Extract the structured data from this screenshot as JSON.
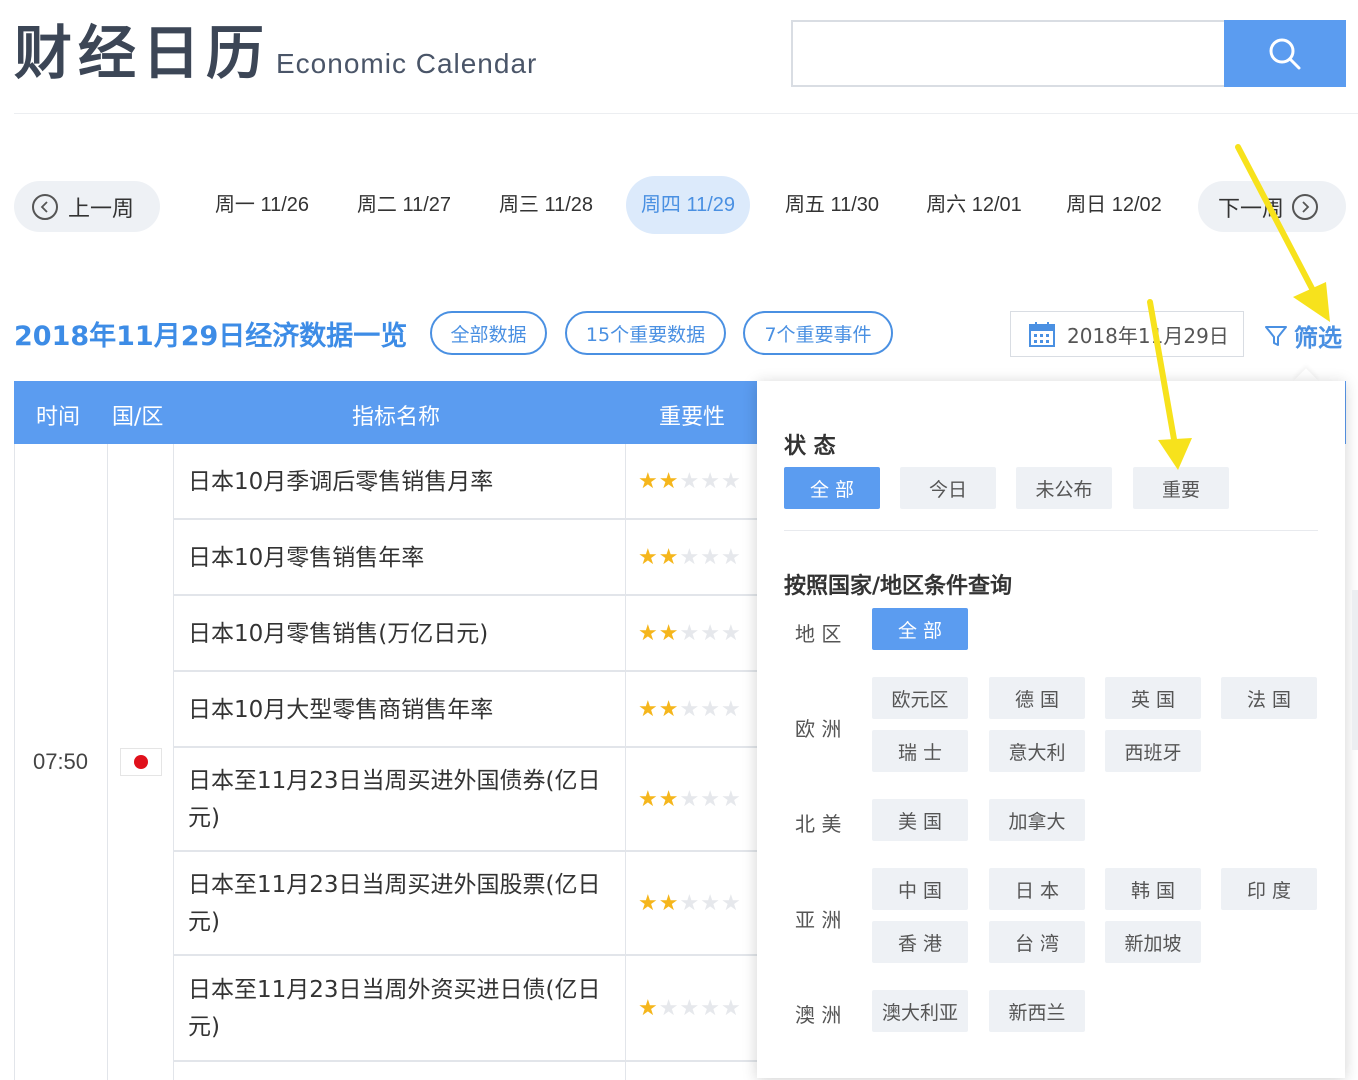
{
  "header": {
    "title_cn": "财经日历",
    "title_en": "Economic Calendar",
    "search_placeholder": ""
  },
  "week_nav": {
    "prev_label": "上一周",
    "next_label": "下一周",
    "days": [
      {
        "label": "周一 11/26",
        "active": false
      },
      {
        "label": "周二 11/27",
        "active": false
      },
      {
        "label": "周三 11/28",
        "active": false
      },
      {
        "label": "周四 11/29",
        "active": true
      },
      {
        "label": "周五 11/30",
        "active": false
      },
      {
        "label": "周六 12/01",
        "active": false
      },
      {
        "label": "周日 12/02",
        "active": false
      }
    ]
  },
  "summary": {
    "title": "2018年11月29日经济数据一览",
    "pills": [
      "全部数据",
      "15个重要数据",
      "7个重要事件"
    ],
    "date": "2018年11月29日",
    "filter_label": "筛选"
  },
  "table": {
    "headers": [
      "时间",
      "国/区",
      "指标名称",
      "重要性"
    ],
    "time": "07:50",
    "country_flag": "japan-flag",
    "rows": [
      {
        "name": "日本10月季调后零售销售月率",
        "stars": 2
      },
      {
        "name": "日本10月零售销售年率",
        "stars": 2
      },
      {
        "name": "日本10月零售销售(万亿日元)",
        "stars": 2
      },
      {
        "name": "日本10月大型零售商销售年率",
        "stars": 2
      },
      {
        "name": "日本至11月23日当周买进外国债券(亿日元)",
        "stars": 2
      },
      {
        "name": "日本至11月23日当周买进外国股票(亿日元)",
        "stars": 2
      },
      {
        "name": "日本至11月23日当周外资买进日债(亿日元)",
        "stars": 1
      }
    ]
  },
  "filter_popup": {
    "status_title": "状 态",
    "status_options": [
      {
        "label": "全 部",
        "active": true
      },
      {
        "label": "今日",
        "active": false
      },
      {
        "label": "未公布",
        "active": false
      },
      {
        "label": "重要",
        "active": false
      }
    ],
    "country_title": "按照国家/地区条件查询",
    "region_all": {
      "label": "地 区",
      "option": "全 部"
    },
    "regions": [
      {
        "label": "欧 洲",
        "options": [
          "欧元区",
          "德 国",
          "英 国",
          "法 国",
          "瑞 士",
          "意大利",
          "西班牙"
        ]
      },
      {
        "label": "北 美",
        "options": [
          "美 国",
          "加拿大"
        ]
      },
      {
        "label": "亚 洲",
        "options": [
          "中 国",
          "日 本",
          "韩 国",
          "印 度",
          "香 港",
          "台 湾",
          "新加坡"
        ]
      },
      {
        "label": "澳 洲",
        "options": [
          "澳大利亚",
          "新西兰"
        ]
      }
    ]
  },
  "colors": {
    "accent": "#5b9cf0",
    "accent_text": "#4a90e2",
    "star": "#f5b61c",
    "annotation_arrow": "#f7e21c"
  }
}
